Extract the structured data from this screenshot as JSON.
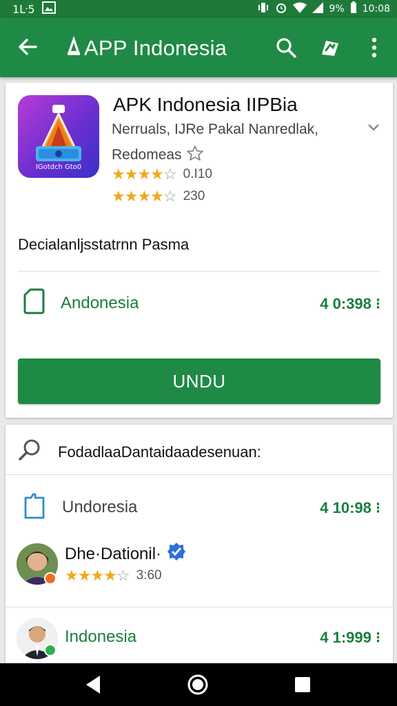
{
  "status_bar": {
    "left_text": "1ᒷ5",
    "battery_percent": "9%",
    "time": "10:08"
  },
  "app_bar": {
    "title": "APP Indonesia",
    "color": "#1f8a45"
  },
  "app": {
    "name": "APK Indonesia IIPBia",
    "subtitle": "Nerruals, IJRe Pakal Nanredlak,",
    "category": "Redomeas",
    "icon_caption": "IGotdch Gto0",
    "rating_1": {
      "stars": 4,
      "value": "0.I10"
    },
    "rating_2": {
      "stars": 4,
      "value": "230"
    },
    "description": "Decialanljsstatrnn Pasma",
    "region_label": "Andonesia",
    "region_value": "4 0:398 ⁝",
    "install_label": "UNDU"
  },
  "related": {
    "search_text": "FodadlaaDantaidaadesenuan:",
    "row1_label": "Undoresia",
    "row1_value": "4 10:98 ⁝",
    "dev_name": "Dhe·Dationil·",
    "dev_rating": {
      "stars": 4,
      "value": "3:60"
    },
    "row2_label": "Indonesia",
    "row2_value": "4 1:999 ⁝"
  },
  "colors": {
    "accent": "#1f8a45",
    "status": "#1f7a3a",
    "star": "#f2a81d",
    "verified": "#2d6fe0"
  },
  "icons": [
    "back-arrow-icon",
    "search-icon",
    "share-icon",
    "more-vert-icon",
    "chevron-down-icon",
    "tag-icon",
    "document-icon"
  ]
}
